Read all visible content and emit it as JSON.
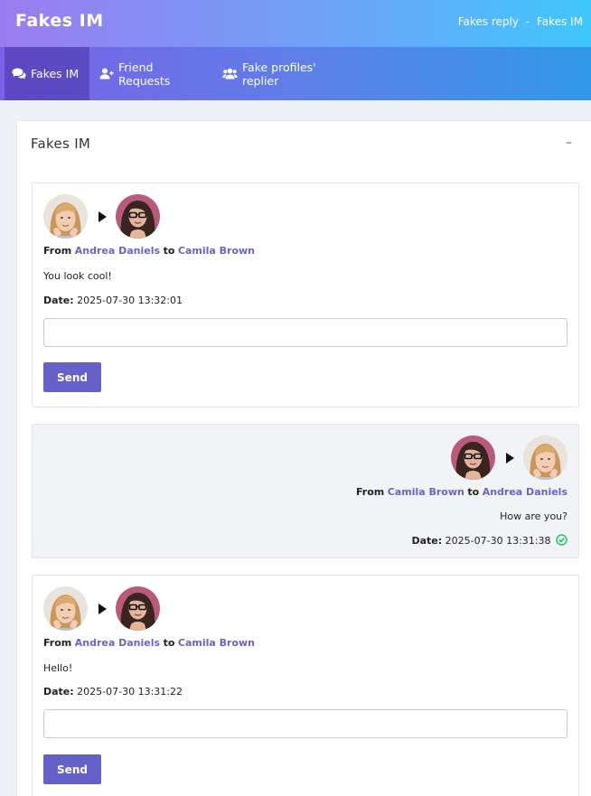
{
  "header": {
    "brand": "Fakes IM",
    "breadcrumb": [
      "Fakes reply",
      "-",
      "Fakes IM"
    ]
  },
  "nav": [
    {
      "label": "Fakes IM",
      "icon": "comments-icon"
    },
    {
      "label": "Friend Requests",
      "icon": "user-plus-icon"
    },
    {
      "label": "Fake profiles' replier",
      "icon": "users-icon"
    }
  ],
  "panel": {
    "title": "Fakes IM",
    "collapse": "–"
  },
  "messages": [
    {
      "from_label": "From",
      "from": "Andrea Daniels",
      "to_label": "to",
      "to": "Camila Brown",
      "text": "You look cool!",
      "date_label": "Date:",
      "date": "2025-07-30 13:32:01",
      "reply_placeholder": "",
      "send_label": "Send"
    },
    {
      "from_label": "From",
      "from": "Camila Brown",
      "to_label": "to",
      "to": "Andrea Daniels",
      "text": "How are you?",
      "date_label": "Date:",
      "date": "2025-07-30 13:31:38",
      "status_icon": "check-circle-icon"
    },
    {
      "from_label": "From",
      "from": "Andrea Daniels",
      "to_label": "to",
      "to": "Camila Brown",
      "text": "Hello!",
      "date_label": "Date:",
      "date": "2025-07-30 13:31:22",
      "reply_placeholder": "",
      "send_label": "Send"
    }
  ],
  "colors": {
    "accent": "#6661c9",
    "name": "#6a63cc",
    "sent_check": "#22c55e"
  }
}
